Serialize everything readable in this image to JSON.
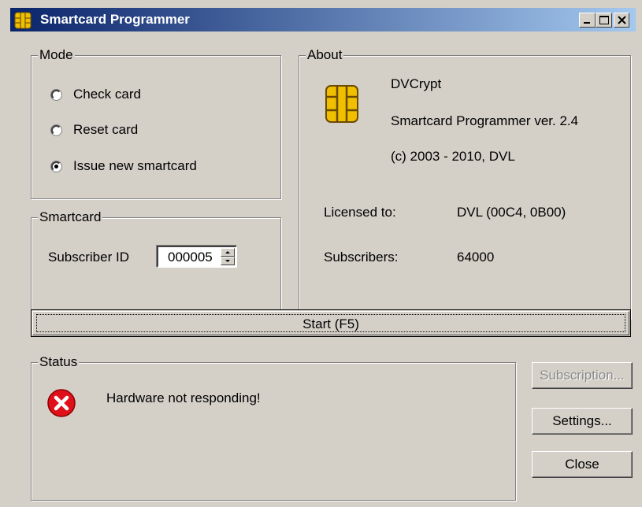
{
  "window": {
    "title": "Smartcard Programmer",
    "title_icon": "smartcard-chip-icon"
  },
  "mode": {
    "label": "Mode",
    "options": [
      {
        "label": "Check card",
        "selected": false
      },
      {
        "label": "Reset card",
        "selected": false
      },
      {
        "label": "Issue new smartcard",
        "selected": true
      }
    ]
  },
  "smartcard": {
    "label": "Smartcard",
    "subscriber_label": "Subscriber ID",
    "subscriber_value": "000005"
  },
  "about": {
    "label": "About",
    "icon": "smartcard-chip-icon",
    "product": "DVCrypt",
    "version": "Smartcard Programmer ver. 2.4",
    "copyright": "(c) 2003 - 2010, DVL",
    "licensed_label": "Licensed to:",
    "licensed_value": "DVL (00C4, 0B00)",
    "subscribers_label": "Subscribers:",
    "subscribers_value": "64000"
  },
  "start_button": "Start (F5)",
  "status": {
    "label": "Status",
    "icon": "error-icon",
    "message": "Hardware not responding!"
  },
  "buttons": {
    "subscription": "Subscription...",
    "settings": "Settings...",
    "close": "Close"
  },
  "colors": {
    "title_bar_start": "#0a246a",
    "title_bar_end": "#a6caf0",
    "face": "#d4d0c8",
    "error_red": "#e0101a",
    "chip_gold": "#f0c000"
  }
}
